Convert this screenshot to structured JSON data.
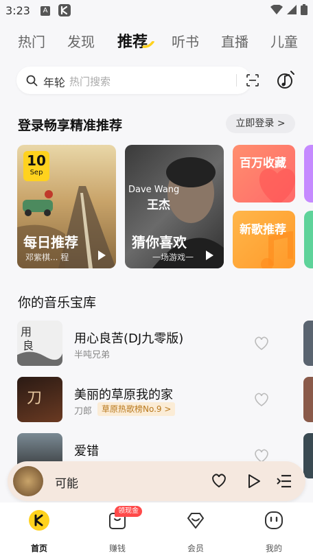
{
  "status": {
    "time": "3:23",
    "notif_a": "A"
  },
  "tabs": [
    "热门",
    "发现",
    "推荐",
    "听书",
    "直播",
    "儿童"
  ],
  "search": {
    "keyword": "年轮",
    "placeholder": "热门搜索"
  },
  "login_section": {
    "title": "登录畅享精准推荐",
    "button": "立即登录 >"
  },
  "cards": {
    "daily": {
      "day": "10",
      "month": "Sep",
      "label": "每日推荐",
      "sub": "邓紫棋... 程"
    },
    "guess": {
      "label": "猜你喜欢",
      "sub": "一场游戏一",
      "cover_text": "Dave Wang",
      "cover_name": "王杰"
    },
    "favorites": {
      "label": "百万收藏"
    },
    "new_songs": {
      "label": "新歌推荐"
    }
  },
  "library": {
    "title": "你的音乐宝库",
    "songs": [
      {
        "title": "用心良苦(DJ九零版)",
        "artist": "半吨兄弟",
        "tag": ""
      },
      {
        "title": "美丽的草原我的家",
        "artist": "刀郎",
        "tag": "草原热歌榜No.9 >"
      },
      {
        "title": "爱错",
        "artist": "",
        "tag": ""
      }
    ]
  },
  "player": {
    "title": "可能"
  },
  "bottom_nav": [
    {
      "label": "首页",
      "active": true
    },
    {
      "label": "赚钱",
      "badge": "领现金"
    },
    {
      "label": "会员"
    },
    {
      "label": "我的"
    }
  ],
  "colors": {
    "brand_yellow": "#ffd21e",
    "accent_red": "#ff4a4a"
  }
}
